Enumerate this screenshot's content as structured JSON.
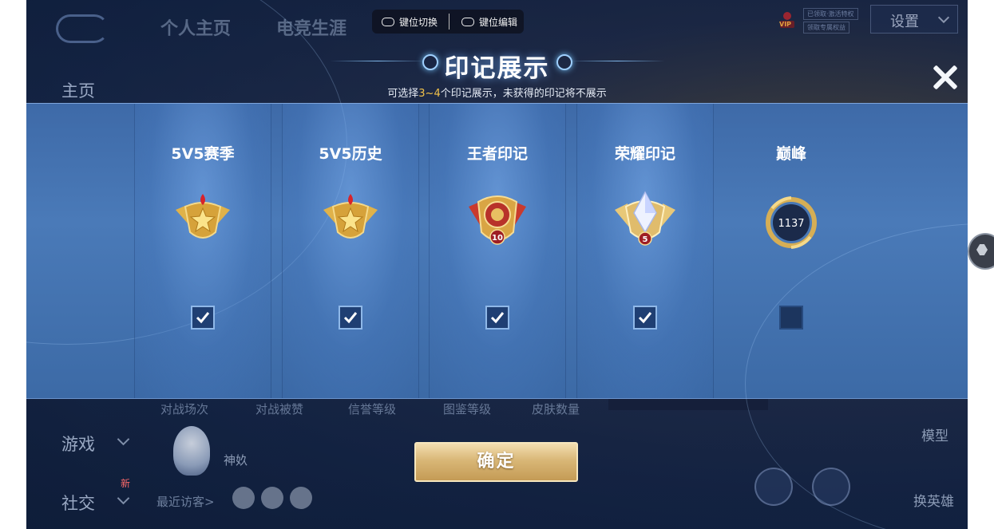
{
  "toolbar": {
    "key_switch": "键位切换",
    "key_edit": "键位编辑"
  },
  "background": {
    "tabs": [
      "个人主页",
      "电竞生涯"
    ],
    "nav": {
      "home": "主页",
      "game": "游戏",
      "social": "社交",
      "new_badge": "新"
    },
    "settings": "设置",
    "vip": {
      "label": "VIP",
      "line1": "已领取·激活特权",
      "line2": "领取专属权益"
    },
    "stats": [
      "对战场次",
      "对战被赞",
      "信誉等级",
      "图鉴等级",
      "皮肤数量"
    ],
    "mascot_name": "神奺",
    "recent_visitors": "最近访客>",
    "model_label": "模型",
    "change_hero_label": "换英雄"
  },
  "modal": {
    "title": "印记展示",
    "subtitle_prefix": "可选择",
    "subtitle_highlight": "3~4",
    "subtitle_suffix": "个印记展示，未获得的印记将不展示",
    "confirm": "确定"
  },
  "marks": [
    {
      "label": "5V5赛季",
      "icon": "gold-star-crest-icon",
      "checked": true
    },
    {
      "label": "5V5历史",
      "icon": "gold-star-crest-icon",
      "checked": true
    },
    {
      "label": "王者印记",
      "icon": "king-emblem-icon",
      "badge_number": "10",
      "checked": true
    },
    {
      "label": "荣耀印记",
      "icon": "glory-crystal-emblem-icon",
      "badge_number": "5",
      "checked": true
    },
    {
      "label": "巅峰",
      "icon": "peak-ring-icon",
      "badge_number": "1137",
      "checked": false
    }
  ],
  "colors": {
    "highlight": "#f2c24a",
    "panel": "#4a7ab8",
    "confirm_gold": "#d9b777"
  }
}
